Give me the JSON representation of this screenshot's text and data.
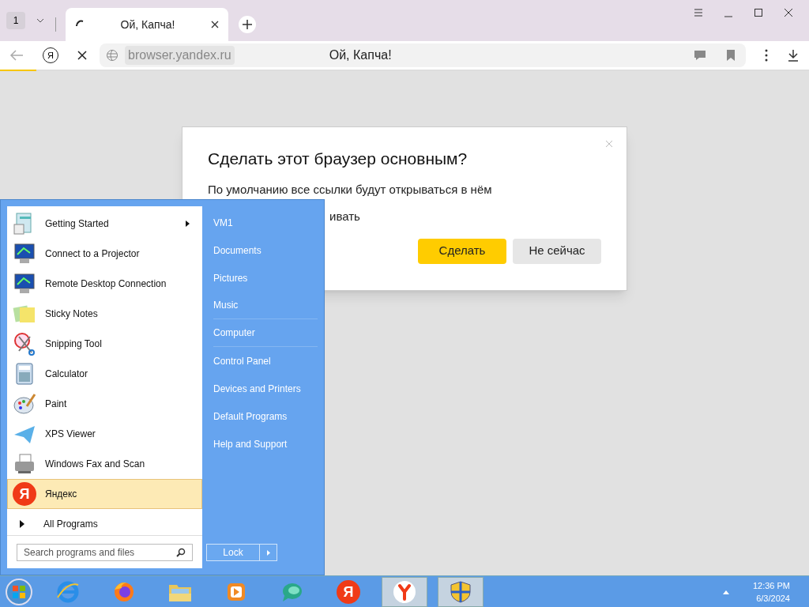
{
  "browser": {
    "tab_count": "1",
    "tabs": [
      {
        "title": "Ой, Капча!",
        "selected": true,
        "loading": true
      }
    ],
    "address": {
      "logo_letter": "Я",
      "url": "browser.yandex.ru",
      "page_title": "Ой, Капча!"
    },
    "load_progress": {
      "level": 0.045
    }
  },
  "dialog": {
    "title": "Сделать этот браузер основным?",
    "text": "По умолчанию все ссылки будут открываться в нём",
    "partial_text": "ивать",
    "buttons": [
      {
        "label": "Сделать",
        "kind": "primary"
      },
      {
        "label": "Не сейчас",
        "kind": "secondary"
      }
    ]
  },
  "start_menu": {
    "programs": [
      {
        "label": "Getting Started",
        "kind": "document",
        "submenu": true,
        "selected": false
      },
      {
        "label": "Connect to a Projector",
        "kind": "monitor",
        "submenu": false,
        "selected": false
      },
      {
        "label": "Remote Desktop Connection",
        "kind": "monitor",
        "submenu": false,
        "selected": false
      },
      {
        "label": "Sticky Notes",
        "kind": "notes",
        "submenu": false,
        "selected": false
      },
      {
        "label": "Snipping Tool",
        "kind": "scissors",
        "submenu": false,
        "selected": false
      },
      {
        "label": "Calculator",
        "kind": "calculator",
        "submenu": false,
        "selected": false
      },
      {
        "label": "Paint",
        "kind": "palette",
        "submenu": false,
        "selected": false
      },
      {
        "label": "XPS Viewer",
        "kind": "plane",
        "submenu": false,
        "selected": false
      },
      {
        "label": "Windows Fax and Scan",
        "kind": "printer",
        "submenu": false,
        "selected": false
      },
      {
        "label": "Яндекс",
        "kind": "letter",
        "icon_text": "Я",
        "submenu": false,
        "selected": true
      }
    ],
    "all_programs": "All Programs",
    "search_placeholder": "Search programs and files",
    "places": [
      {
        "label": "VM1",
        "separator_after": false
      },
      {
        "label": "Documents",
        "separator_after": false
      },
      {
        "label": "Pictures",
        "separator_after": false
      },
      {
        "label": "Music",
        "separator_after": true
      },
      {
        "label": "Computer",
        "separator_after": true
      },
      {
        "label": "Control Panel",
        "separator_after": false
      },
      {
        "label": "Devices and Printers",
        "separator_after": false
      },
      {
        "label": "Default Programs",
        "separator_after": false
      },
      {
        "label": "Help and Support",
        "separator_after": false
      }
    ],
    "lock_button": "Lock"
  },
  "taskbar": {
    "items": [
      {
        "kind": "ie",
        "active": false
      },
      {
        "kind": "firefox",
        "active": false
      },
      {
        "kind": "folder",
        "active": false
      },
      {
        "kind": "media",
        "active": false
      },
      {
        "kind": "bubble",
        "active": false
      },
      {
        "kind": "yandex",
        "text": "Я",
        "active": false
      },
      {
        "kind": "yandex-browser",
        "active": true
      },
      {
        "kind": "shield",
        "active": true
      }
    ],
    "time": "12:36 PM",
    "date": "6/3/2024"
  }
}
